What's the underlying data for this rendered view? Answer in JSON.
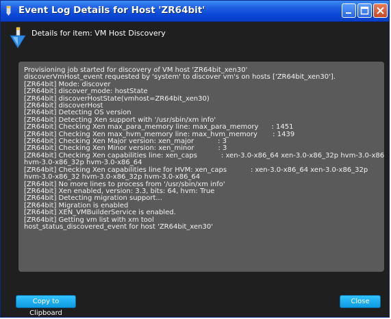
{
  "window": {
    "title": "Event Log Details for Host 'ZR64bit'"
  },
  "header": {
    "details_label": "Details for item: VM Host Discovery"
  },
  "log": {
    "lines": [
      "Provisioning job started for discovery of VM host 'ZR64bit_xen30'",
      "discoverVmHost_event requested by 'system' to discover vm's on hosts ['ZR64bit_xen30'].",
      "[ZR64bit] Mode: discover",
      "[ZR64bit] discover_mode: hostState",
      "[ZR64bit] discoverHostState(vmhost=ZR64bit_xen30)",
      "[ZR64bit] discoverHost",
      "[ZR64bit] Detecting OS version",
      "[ZR64bit] Detecting Xen support with '/usr/sbin/xm info'",
      "[ZR64bit] Checking Xen max_para_memory line: max_para_memory      : 1451",
      "[ZR64bit] Checking Xen max_hvm_memory line: max_hvm_memory       : 1439",
      "[ZR64bit] Checking Xen Major version: xen_major           : 3",
      "[ZR64bit] Checking Xen Minor version: xen_minor           : 3",
      "[ZR64bit] Checking Xen capabilities line: xen_caps           : xen-3.0-x86_64 xen-3.0-x86_32p hvm-3.0-x86_32",
      "hvm-3.0-x86_32p hvm-3.0-x86_64",
      "[ZR64bit] Checking Xen capabilities line for HVM: xen_caps           : xen-3.0-x86_64 xen-3.0-x86_32p",
      "hvm-3.0-x86_32 hvm-3.0-x86_32p hvm-3.0-x86_64",
      "[ZR64bit] No more lines to process from '/usr/sbin/xm info'",
      "[ZR64bit] Xen enabled, version: 3.3, bits: 64, hvm: True",
      "[ZR64bit] Detecting migration support...",
      "[ZR64bit] Migration is enabled",
      "[ZR64bit] XEN_VMBuilderService is enabled.",
      "[ZR64bit] Getting vm list with xm tool",
      "host_status_discovered_event for host 'ZR64bit_xen30'"
    ]
  },
  "buttons": {
    "copy_label": "Copy to Clipboard",
    "close_label": "Close"
  },
  "icons": {
    "title": "app-icon",
    "header": "wizard-arrow-icon",
    "minimize": "minimize-icon",
    "maximize": "maximize-icon",
    "close": "close-icon"
  },
  "colors": {
    "titlebar": "#0a46d6",
    "background": "#1f1f1f",
    "log_box": "#5a5a5a",
    "button": "#1aacef"
  }
}
